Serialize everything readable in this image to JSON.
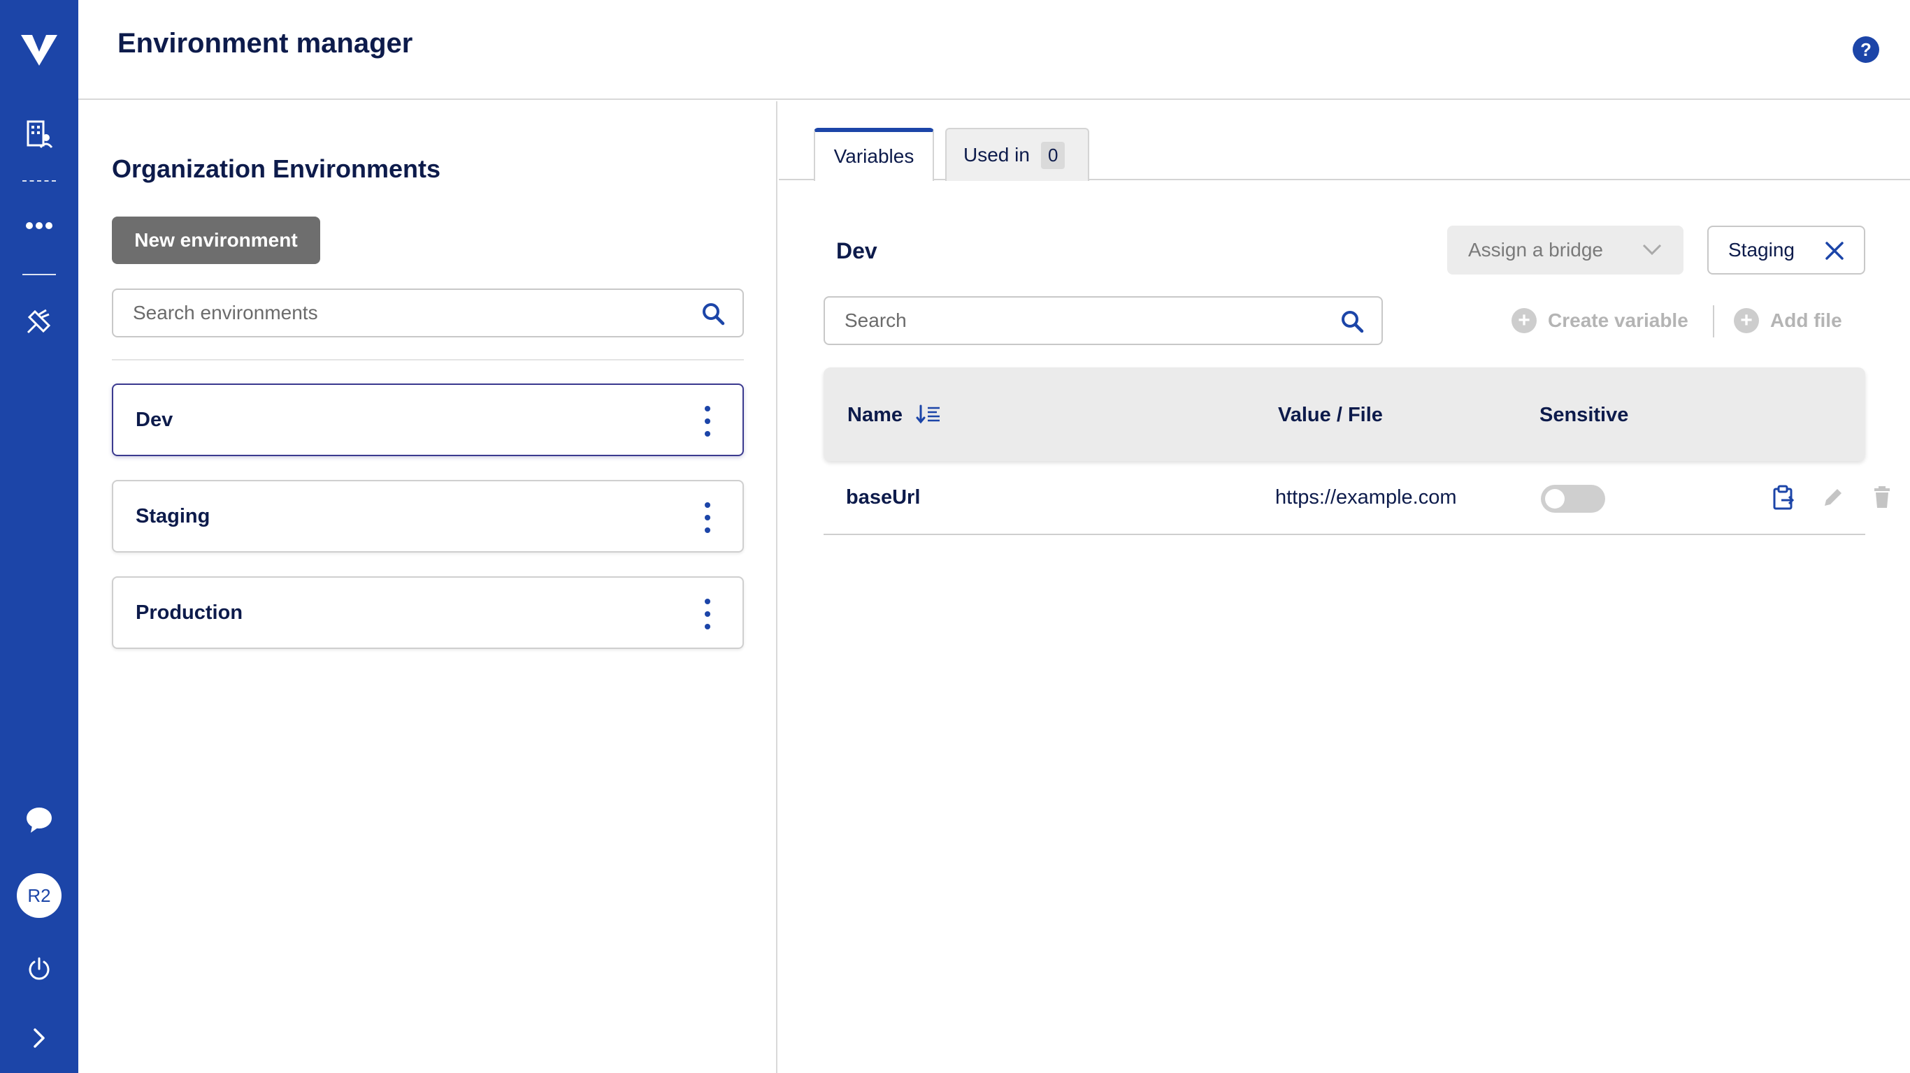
{
  "app": {
    "title": "Environment manager",
    "accent_color": "#1c45a8",
    "help_icon": "?"
  },
  "sidebar": {
    "logo": "V",
    "avatar_initials": "R2",
    "items": [
      {
        "name": "organization-icon"
      },
      {
        "name": "more-icon"
      },
      {
        "name": "tools-icon"
      },
      {
        "name": "chat-icon"
      },
      {
        "name": "power-icon"
      },
      {
        "name": "expand-icon"
      }
    ]
  },
  "left": {
    "section_title": "Organization Environments",
    "new_button": "New environment",
    "search_placeholder": "Search environments",
    "environments": [
      {
        "name": "Dev",
        "selected": true
      },
      {
        "name": "Staging",
        "selected": false
      },
      {
        "name": "Production",
        "selected": false
      }
    ]
  },
  "right": {
    "tabs": [
      {
        "label": "Variables",
        "active": true
      },
      {
        "label": "Used in",
        "count": "0",
        "active": false
      }
    ],
    "env_name": "Dev",
    "bridge_placeholder": "Assign a bridge",
    "chip_label": "Staging",
    "search_placeholder": "Search",
    "create_variable": "Create variable",
    "add_file": "Add file",
    "table": {
      "columns": [
        "Name",
        "Value / File",
        "Sensitive"
      ],
      "rows": [
        {
          "name": "baseUrl",
          "value": "https://example.com",
          "sensitive": false
        }
      ]
    }
  }
}
